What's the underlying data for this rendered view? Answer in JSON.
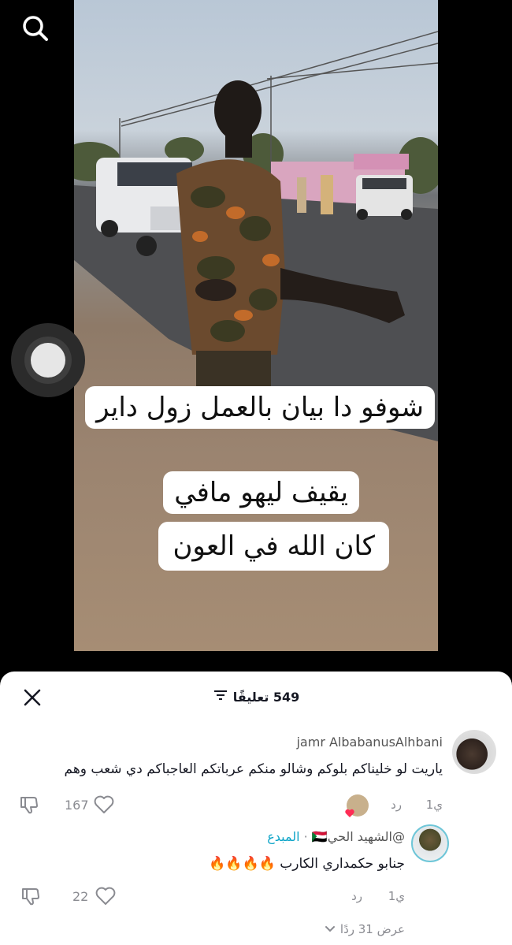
{
  "caption": {
    "lines": [
      "شوفو  دا بيان بالعمل زول داير",
      "يقيف ليهو مافي",
      "كان الله في العون"
    ],
    "line_right_parts": [
      "شوفو"
    ]
  },
  "comments_panel": {
    "count_label": "549 تعليقًا",
    "comments": [
      {
        "username": "jamr AlbabanusAlhbani",
        "text": "ياريت لو خليناكم بلوكم وشالو منكم عرباتكم العاجباكم دي شعب وهم",
        "time": "1ي",
        "reply_label": "رد",
        "likes": "167"
      },
      {
        "username": "الشهيد الحي🇸🇩",
        "username_prefix": "@",
        "badge": "المبدع",
        "separator": "·",
        "text": "جنابو حكمداري الكارب 🔥🔥🔥🔥",
        "time": "1ي",
        "reply_label": "رد",
        "likes": "22"
      }
    ],
    "view_replies": "عرض 31 ردًا"
  }
}
